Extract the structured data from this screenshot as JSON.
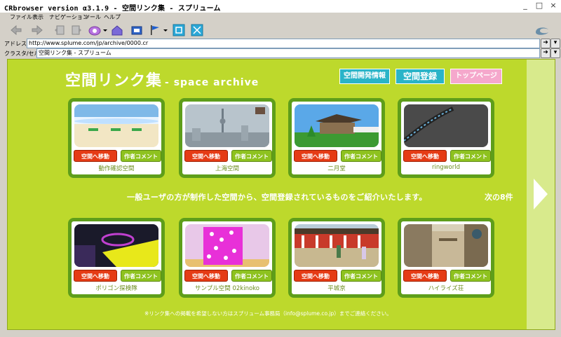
{
  "window": {
    "title": "CRbrowser version α3.1.9 - 空間リンク集 - スプリューム",
    "min": "_",
    "max": "□",
    "close": "×"
  },
  "menu": [
    "ファイル",
    "表示",
    "ナビゲーション",
    "ツール",
    "ヘルプ"
  ],
  "address": {
    "label": "アドレス",
    "value": "http://www.splume.com/jp/archive/0000.cr"
  },
  "cluster": {
    "label": "クラスタ/セル",
    "value": "空間リンク集 - スプリューム"
  },
  "page": {
    "title": "空間リンク集",
    "subtitle": "- space archive",
    "top_buttons": [
      "空間開発情報",
      "空間登録",
      "トップページ"
    ],
    "go_label": "空間へ移動",
    "comment_label": "作者コメント",
    "cards": [
      {
        "name": "動作確認空間"
      },
      {
        "name": "上海空間"
      },
      {
        "name": "二月堂"
      },
      {
        "name": "ringworld"
      },
      {
        "name": "ポリゴン探検隊"
      },
      {
        "name": "サンプル空間 02kinoko"
      },
      {
        "name": "平城京"
      },
      {
        "name": "ハイライズ荘"
      }
    ],
    "announcement": "一般ユーザの方が制作した空間から、空間登録されているものをご紹介いたします。",
    "next": "次の8件",
    "footer": "※リンク集への掲載を希望しない方はスプリューム事務局（info@splume.co.jp）までご連絡ください。"
  },
  "colors": {
    "page_bg": "#bdd92c",
    "card_border": "#5e9e1a",
    "go_button": "#e53b15",
    "comment_button": "#8ec21f"
  }
}
